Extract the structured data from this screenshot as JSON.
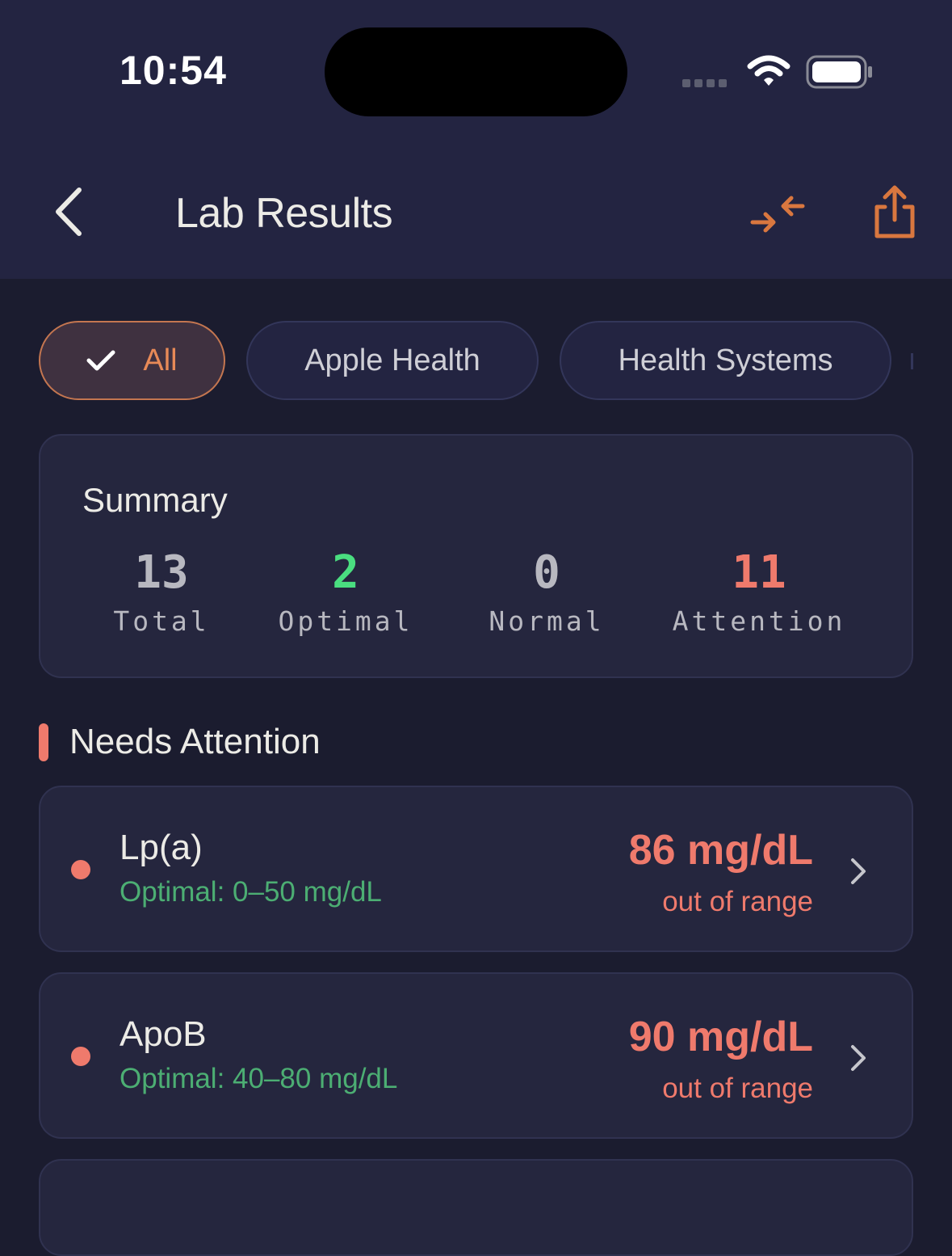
{
  "status_bar": {
    "time": "10:54"
  },
  "header": {
    "title": "Lab Results",
    "colors": {
      "accent": "#d9773f"
    }
  },
  "filters": [
    {
      "label": "All",
      "selected": true
    },
    {
      "label": "Apple Health",
      "selected": false
    },
    {
      "label": "Health Systems",
      "selected": false
    }
  ],
  "summary": {
    "title": "Summary",
    "stats": [
      {
        "value": "13",
        "label": "Total",
        "color": "#b8b8c0"
      },
      {
        "value": "2",
        "label": "Optimal",
        "color": "#4ade80"
      },
      {
        "value": "0",
        "label": "Normal",
        "color": "#b8b8c0"
      },
      {
        "value": "11",
        "label": "Attention",
        "color": "#ef7a6c"
      }
    ]
  },
  "section": {
    "title": "Needs Attention"
  },
  "results": [
    {
      "name": "Lp(a)",
      "optimal": "Optimal: 0–50 mg/dL",
      "value": "86 mg/dL",
      "status": "out of range"
    },
    {
      "name": "ApoB",
      "optimal": "Optimal: 40–80 mg/dL",
      "value": "90 mg/dL",
      "status": "out of range"
    }
  ]
}
